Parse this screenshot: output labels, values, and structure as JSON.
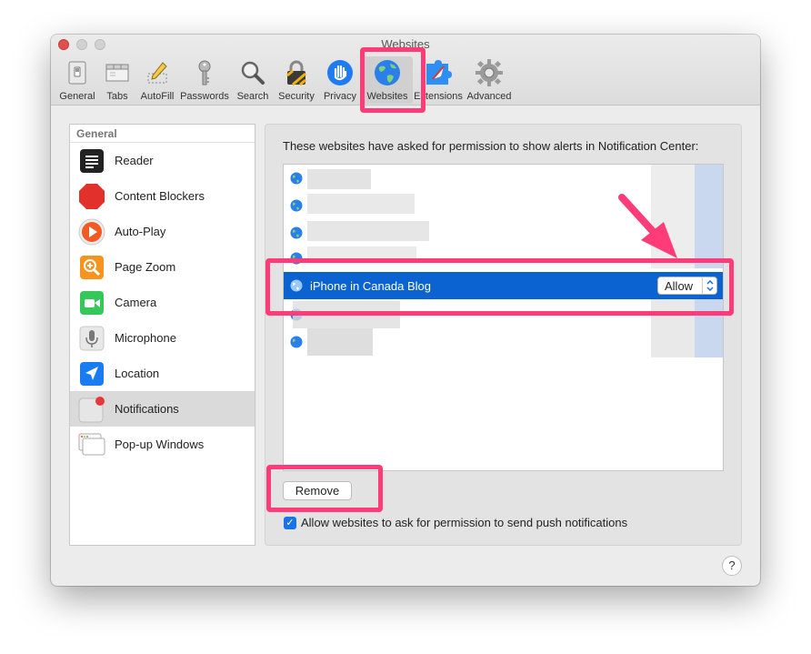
{
  "window": {
    "title": "Websites"
  },
  "toolbar": {
    "items": [
      {
        "label": "General",
        "icon": "general-switch-icon"
      },
      {
        "label": "Tabs",
        "icon": "tabs-icon"
      },
      {
        "label": "AutoFill",
        "icon": "autofill-pencil-icon"
      },
      {
        "label": "Passwords",
        "icon": "key-icon"
      },
      {
        "label": "Search",
        "icon": "magnifier-icon"
      },
      {
        "label": "Security",
        "icon": "lock-icon"
      },
      {
        "label": "Privacy",
        "icon": "hand-icon"
      },
      {
        "label": "Websites",
        "icon": "globe-icon",
        "selected": true
      },
      {
        "label": "Extensions",
        "icon": "puzzle-icon"
      },
      {
        "label": "Advanced",
        "icon": "gear-icon"
      }
    ]
  },
  "sidebar": {
    "header": "General",
    "items": [
      {
        "label": "Reader",
        "icon": "reader-icon"
      },
      {
        "label": "Content Blockers",
        "icon": "stop-sign-icon"
      },
      {
        "label": "Auto-Play",
        "icon": "play-icon"
      },
      {
        "label": "Page Zoom",
        "icon": "zoom-icon"
      },
      {
        "label": "Camera",
        "icon": "camera-icon"
      },
      {
        "label": "Microphone",
        "icon": "microphone-icon"
      },
      {
        "label": "Location",
        "icon": "location-arrow-icon"
      },
      {
        "label": "Notifications",
        "icon": "notifications-icon",
        "selected": true
      },
      {
        "label": "Pop-up Windows",
        "icon": "popup-windows-icon"
      }
    ]
  },
  "panel": {
    "description": "These websites have asked for permission to show alerts in Notification Center:",
    "selected_site": {
      "name": "iPhone in Canada Blog",
      "setting": "Allow"
    },
    "remove_label": "Remove",
    "checkbox_label": "Allow websites to ask for permission to send push notifications",
    "checkbox_checked": true
  },
  "help": {
    "label": "?"
  },
  "colors": {
    "highlight": "#ff3b7a",
    "selection": "#0a63d0",
    "checkbox": "#1a72e8"
  }
}
